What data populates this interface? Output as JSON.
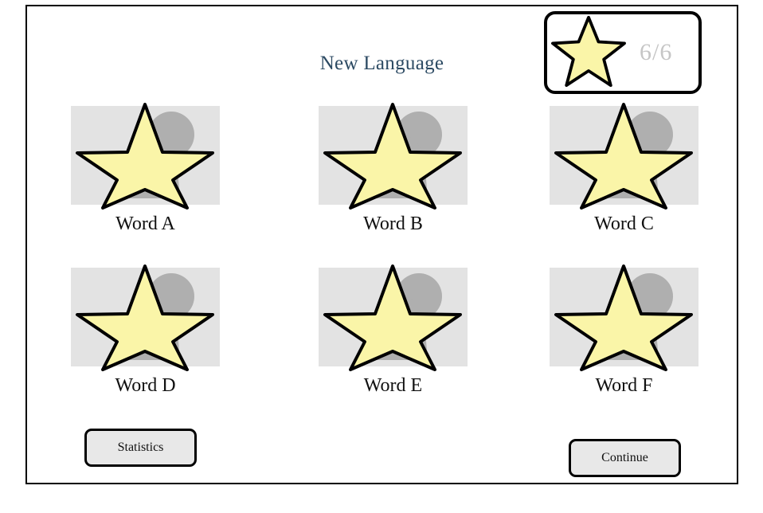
{
  "window": {
    "title": "New Language"
  },
  "progress": {
    "icon": "star-icon",
    "count_label": "6/6",
    "completed": 6,
    "total": 6
  },
  "colors": {
    "frame_border": "#000000",
    "title_text": "#2c4a63",
    "card_background": "#e3e3e3",
    "star_fill": "#faf5a8",
    "star_outline": "#000000",
    "silhouette_gray": "#afafaf",
    "count_text": "#c6c6c6",
    "button_face": "#e8e8e8"
  },
  "grid": {
    "cards": [
      {
        "label": "Word A",
        "icon": "star-icon",
        "row": 0,
        "col": 0
      },
      {
        "label": "Word B",
        "icon": "star-icon",
        "row": 0,
        "col": 1
      },
      {
        "label": "Word C",
        "icon": "star-icon",
        "row": 0,
        "col": 2
      },
      {
        "label": "Word D",
        "icon": "star-icon",
        "row": 1,
        "col": 0
      },
      {
        "label": "Word E",
        "icon": "star-icon",
        "row": 1,
        "col": 1
      },
      {
        "label": "Word F",
        "icon": "star-icon",
        "row": 1,
        "col": 2
      }
    ]
  },
  "footer": {
    "statistics_label": "Statistics",
    "continue_label": "Continue"
  }
}
